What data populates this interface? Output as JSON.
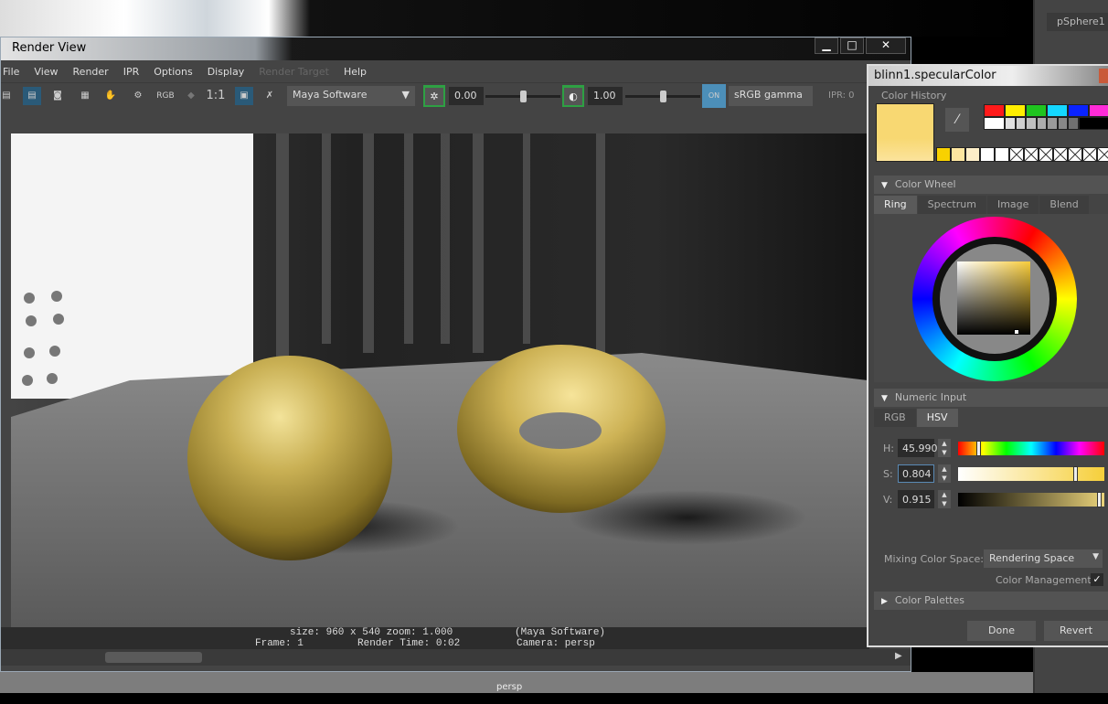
{
  "background": {
    "outliner_item": "pSphere1",
    "viewport_label": "persp"
  },
  "render_view": {
    "title": "Render View",
    "window_buttons": [
      "minimize",
      "maximize",
      "close"
    ],
    "menu": [
      {
        "label": "File"
      },
      {
        "label": "View"
      },
      {
        "label": "Render"
      },
      {
        "label": "IPR"
      },
      {
        "label": "Options"
      },
      {
        "label": "Display"
      },
      {
        "label": "Render Target",
        "disabled": true
      },
      {
        "label": "Help"
      }
    ],
    "toolbar": {
      "rgb_label": "RGB",
      "ratio_label": "1:1",
      "renderer": "Maya Software",
      "exposure": "0.00",
      "gamma": "1.00",
      "color_mgmt_badge": "ON",
      "view_transform": "sRGB gamma",
      "ipr_label": "IPR: 0"
    },
    "status": {
      "line1": "size: 960 x 540 zoom: 1.000",
      "renderer": "(Maya Software)",
      "frame": "Frame: 1",
      "render_time": "Render Time: 0:02",
      "camera": "Camera: persp"
    }
  },
  "color_editor": {
    "title": "blinn1.specularColor",
    "current_color": "#f9d978",
    "history_label": "Color History",
    "swatches_top": [
      "#ff1a1a",
      "#ffee00",
      "#1fc41f",
      "#14d7ff",
      "#0a23ff",
      "#ff2bd8"
    ],
    "swatches_gray": [
      "#ffffff",
      "#e0e0e0",
      "#cfcfcf",
      "#bfbfbf",
      "#adadad",
      "#9a9a9a",
      "#888888",
      "#707070",
      "#000000"
    ],
    "swatches_history": [
      "#f8d100",
      "#fde6a0",
      "#fdeec8",
      "#ffffff",
      "#ffffff"
    ],
    "color_wheel_label": "Color Wheel",
    "wheel_tabs": [
      "Ring",
      "Spectrum",
      "Image",
      "Blend"
    ],
    "numeric_label": "Numeric Input",
    "numeric_tabs": [
      "RGB",
      "HSV"
    ],
    "h_label": "H:",
    "h": "45.990",
    "s_label": "S:",
    "s": "0.804",
    "v_label": "V:",
    "v": "0.915",
    "mixing_label": "Mixing Color Space:",
    "mixing_value": "Rendering Space",
    "color_management_label": "Color Management",
    "color_management": true,
    "palettes_label": "Color Palettes",
    "done": "Done",
    "revert": "Revert"
  }
}
